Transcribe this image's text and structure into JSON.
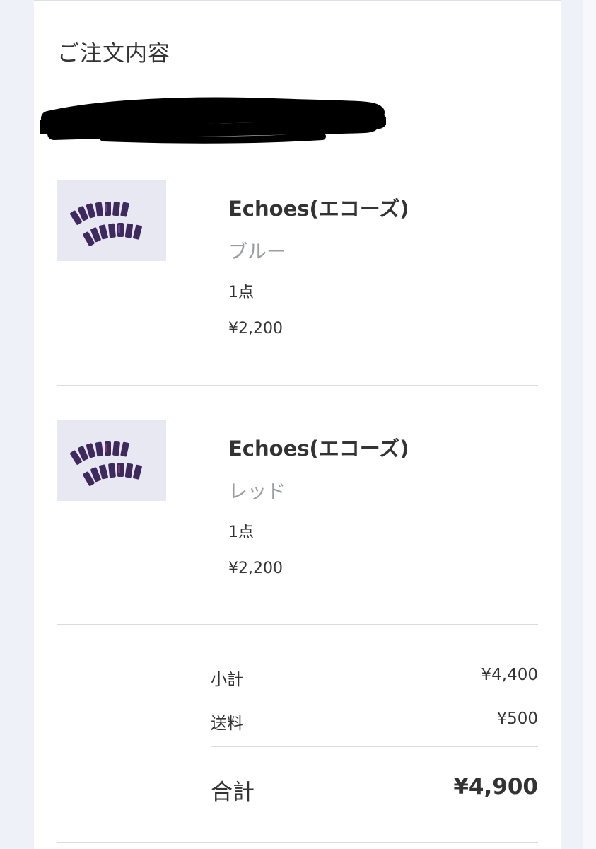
{
  "order": {
    "section_title": "ご注文内容",
    "items": [
      {
        "name": "Echoes(エコーズ)",
        "variant": "ブルー",
        "quantity": "1点",
        "price": "¥2,200"
      },
      {
        "name": "Echoes(エコーズ)",
        "variant": "レッド",
        "quantity": "1点",
        "price": "¥2,200"
      }
    ],
    "summary": {
      "subtotal_label": "小計",
      "subtotal_value": "¥4,400",
      "shipping_label": "送料",
      "shipping_value": "¥500",
      "total_label": "合計",
      "total_value": "¥4,900"
    }
  },
  "colors": {
    "page_background": "#eef1f8",
    "card_background": "#ffffff",
    "text_primary": "#333333",
    "text_muted": "#9a9ca4",
    "divider": "#dcdcdc",
    "redaction": "#000000"
  }
}
